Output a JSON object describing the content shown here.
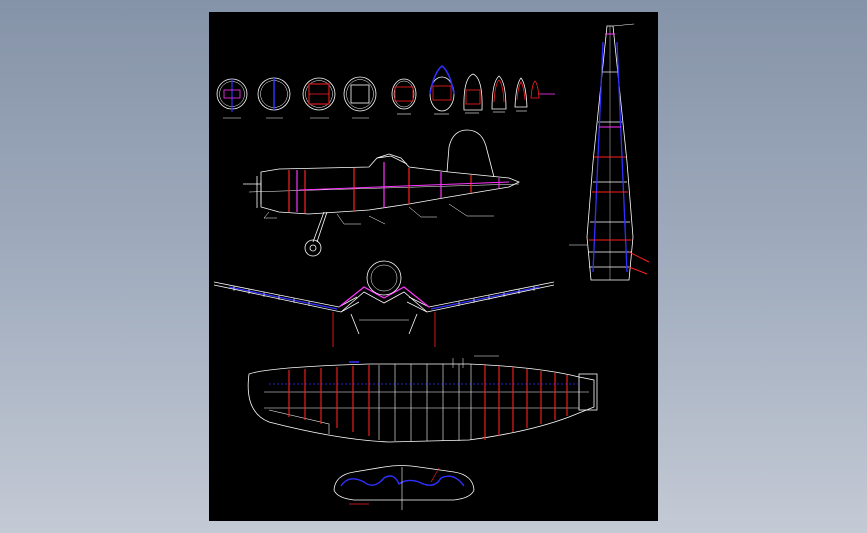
{
  "viewport": {
    "background_colors": [
      "#8593a8",
      "#c4cad5"
    ]
  },
  "drawing": {
    "subject": "aircraft-plan",
    "colors": {
      "sheet": "#000000",
      "outline": "#ffffff",
      "former": "#ff2020",
      "spar": "#3030ff",
      "stringer": "#ff33ff"
    },
    "views": [
      "fuselage-formers",
      "side-view",
      "front-view",
      "wing-plan-view",
      "tailplane-plan-view",
      "fuselage-top-view"
    ]
  }
}
